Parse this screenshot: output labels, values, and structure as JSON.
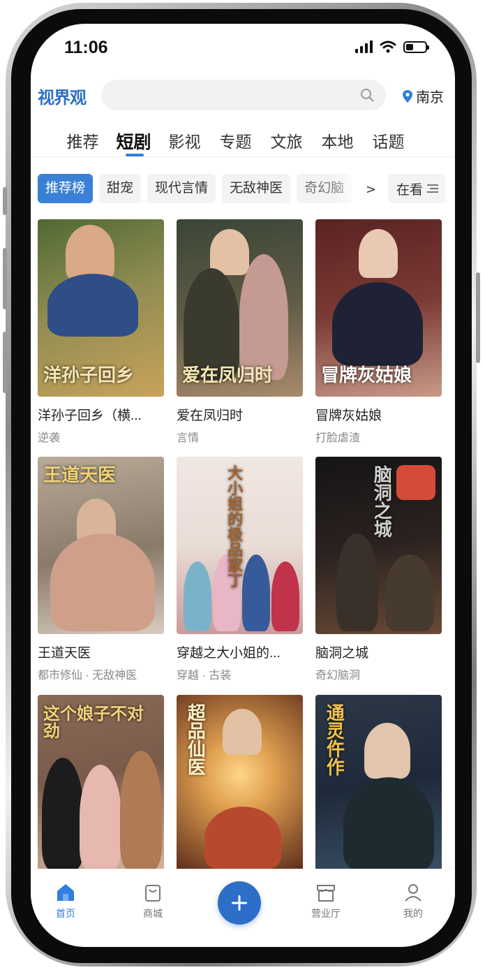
{
  "status_bar": {
    "time": "11:06"
  },
  "header": {
    "logo": "视界观",
    "search": {
      "placeholder": "",
      "value": ""
    },
    "location": "南京"
  },
  "tabs": [
    {
      "label": "推荐",
      "active": false
    },
    {
      "label": "短剧",
      "active": true
    },
    {
      "label": "影视",
      "active": false
    },
    {
      "label": "专题",
      "active": false
    },
    {
      "label": "文旅",
      "active": false
    },
    {
      "label": "本地",
      "active": false
    },
    {
      "label": "话题",
      "active": false
    }
  ],
  "chips": [
    {
      "label": "推荐榜",
      "active": true
    },
    {
      "label": "甜宠",
      "active": false
    },
    {
      "label": "现代言情",
      "active": false
    },
    {
      "label": "无敌神医",
      "active": false
    },
    {
      "label": "奇幻脑",
      "active": false
    }
  ],
  "chips_more": ">",
  "watching_label": "在看",
  "cards": [
    {
      "title": "洋孙子回乡（横...",
      "tag": "逆袭",
      "poster_text": "洋孙子回乡",
      "colors": [
        "#6b7a3a",
        "#c9a35a"
      ]
    },
    {
      "title": "爱在凤归时",
      "tag": "言情",
      "poster_text": "爱在凤归时",
      "colors": [
        "#3d4a3a",
        "#a88a6b"
      ]
    },
    {
      "title": "冒牌灰姑娘",
      "tag": "打脸虐渣",
      "poster_text": "冒牌灰姑娘",
      "colors": [
        "#6a2b2b",
        "#c79a88"
      ]
    },
    {
      "title": "王道天医",
      "tag": "都市修仙 · 无敌神医",
      "poster_text": "王道天医",
      "colors": [
        "#8a7a6a",
        "#d8ccbf"
      ]
    },
    {
      "title": "穿越之大小姐的...",
      "tag": "穿越 · 古装",
      "poster_text": "大小姐的极品家丁",
      "colors": [
        "#e9ddd6",
        "#c99b9b"
      ]
    },
    {
      "title": "脑洞之城",
      "tag": "奇幻脑洞",
      "poster_text": "脑洞之城",
      "colors": [
        "#1c1a1a",
        "#6b4a35"
      ]
    },
    {
      "title": "",
      "tag": "",
      "poster_text": "这个娘子不对劲",
      "colors": [
        "#7a5a4a",
        "#d9b8a0"
      ]
    },
    {
      "title": "",
      "tag": "",
      "poster_text": "超品仙医",
      "colors": [
        "#5a2a1a",
        "#e0a050"
      ]
    },
    {
      "title": "",
      "tag": "",
      "poster_text": "通灵仵作",
      "colors": [
        "#1e2a3a",
        "#3c4f66"
      ]
    }
  ],
  "bottom_nav": [
    {
      "label": "首页",
      "icon": "home-icon",
      "active": true
    },
    {
      "label": "商城",
      "icon": "shopping-bag-icon",
      "active": false
    },
    {
      "label": "",
      "icon": "plus-icon",
      "active": false
    },
    {
      "label": "营业厅",
      "icon": "store-icon",
      "active": false
    },
    {
      "label": "我的",
      "icon": "user-icon",
      "active": false
    }
  ],
  "colors": {
    "accent": "#2f7fe0",
    "logo": "#2b6fc6",
    "active_chip": "#3a80d6"
  }
}
